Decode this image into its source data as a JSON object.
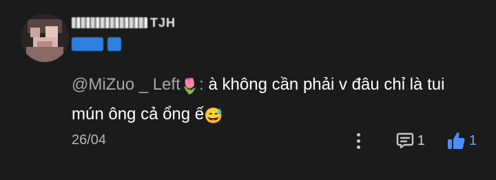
{
  "comment": {
    "user": {
      "name_suffix": "TJH",
      "badges": [
        "",
        ""
      ]
    },
    "mention": "@MiZuo _ Left",
    "mention_emoji": "🌷",
    "separator": ":",
    "text": " à không cần phải v đâu chỉ là tui mún ông cả ổng ế",
    "trailing_emoji": "😅",
    "date": "26/04",
    "reply_count": "1",
    "like_count": "1"
  },
  "icons": {
    "more": "vertical-dots-icon",
    "reply": "comment-bubble-icon",
    "like": "thumbs-up-icon"
  },
  "colors": {
    "background": "#1b1b1b",
    "mention": "#a8a8a8",
    "badge": "#2f7fe0",
    "like_accent": "#4a90ff"
  }
}
